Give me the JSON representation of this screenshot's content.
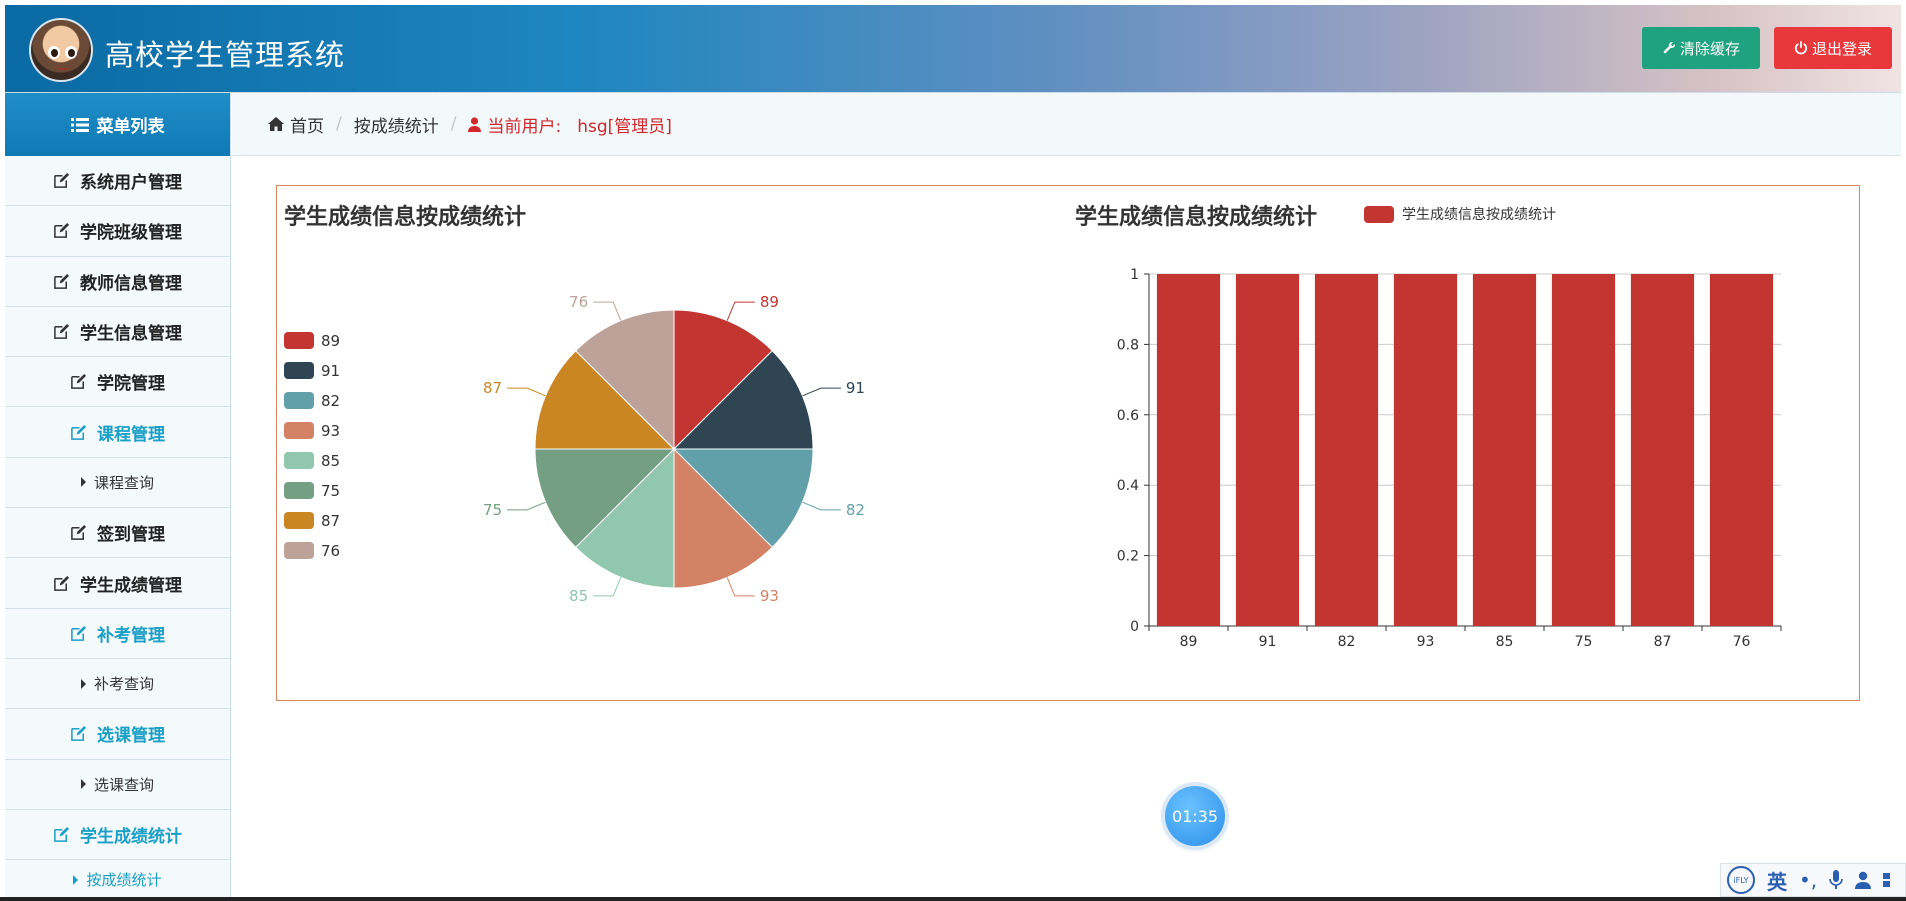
{
  "header": {
    "app_title": "高校学生管理系统",
    "clear_cache_label": "清除缓存",
    "logout_label": "退出登录",
    "clear_color": "#1fa27f",
    "logout_color": "#e8383c"
  },
  "sidebar": {
    "head_label": "菜单列表",
    "items": [
      {
        "label": "系统用户管理",
        "type": "top"
      },
      {
        "label": "学院班级管理",
        "type": "top"
      },
      {
        "label": "教师信息管理",
        "type": "top"
      },
      {
        "label": "学生信息管理",
        "type": "top"
      },
      {
        "label": "学院管理",
        "type": "top"
      },
      {
        "label": "课程管理",
        "type": "sub"
      },
      {
        "label": "课程查询",
        "type": "child"
      },
      {
        "label": "签到管理",
        "type": "top"
      },
      {
        "label": "学生成绩管理",
        "type": "top"
      },
      {
        "label": "补考管理",
        "type": "sub"
      },
      {
        "label": "补考查询",
        "type": "child"
      },
      {
        "label": "选课管理",
        "type": "sub"
      },
      {
        "label": "选课查询",
        "type": "child"
      },
      {
        "label": "学生成绩统计",
        "type": "sub"
      },
      {
        "label": "按成绩统计",
        "type": "child-active"
      }
    ]
  },
  "breadcrumb": {
    "home": "首页",
    "current": "按成绩统计",
    "user_label": "当前用户:",
    "user_name": "hsg[管理员]"
  },
  "chart_data": [
    {
      "type": "pie",
      "title": "学生成绩信息按成绩统计",
      "legend": "left",
      "categories": [
        "89",
        "91",
        "82",
        "93",
        "85",
        "75",
        "87",
        "76"
      ],
      "values": [
        1,
        1,
        1,
        1,
        1,
        1,
        1,
        1
      ],
      "colors": [
        "#c23531",
        "#2f4554",
        "#61a0a8",
        "#d48265",
        "#91c7ae",
        "#749f83",
        "#ca8622",
        "#bda29a"
      ]
    },
    {
      "type": "bar",
      "title": "学生成绩信息按成绩统计",
      "legend": "top",
      "categories": [
        "89",
        "91",
        "82",
        "93",
        "85",
        "75",
        "87",
        "76"
      ],
      "series": [
        {
          "name": "学生成绩信息按成绩统计",
          "values": [
            1,
            1,
            1,
            1,
            1,
            1,
            1,
            1
          ]
        }
      ],
      "ylim": [
        0,
        1
      ],
      "yticks": [
        "0",
        "0.2",
        "0.4",
        "0.6",
        "0.8",
        "1"
      ],
      "grid": true,
      "color": "#c23531"
    }
  ],
  "timer": {
    "text": "01:35"
  },
  "ime": {
    "badge": "iFLY",
    "mode": "英"
  }
}
